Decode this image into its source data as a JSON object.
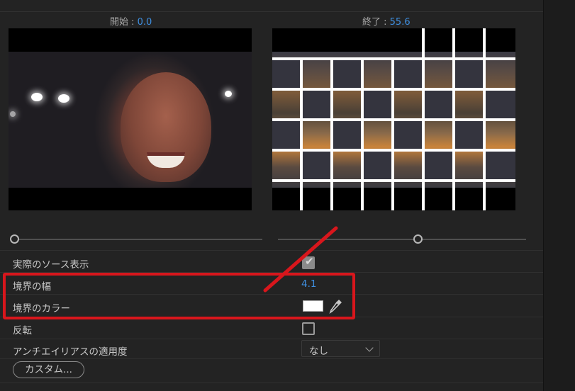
{
  "header": {
    "start_label": "開始 : ",
    "start_value": "0.0",
    "end_label": "終了 :  ",
    "end_value": "55.6"
  },
  "properties": {
    "show_actual_source": {
      "label": "実際のソース表示",
      "checked": true
    },
    "border_width": {
      "label": "境界の幅",
      "value": "4.1"
    },
    "border_color": {
      "label": "境界のカラー",
      "color": "#ffffff"
    },
    "reverse": {
      "label": "反転",
      "checked": false
    },
    "antialias": {
      "label": "アンチエイリアスの適用度",
      "value": "なし"
    }
  },
  "buttons": {
    "custom": "カスタム..."
  },
  "colors": {
    "accent_value": "#3f8fe0",
    "annotation_red": "#d8161c",
    "panel_bg": "#232323"
  }
}
